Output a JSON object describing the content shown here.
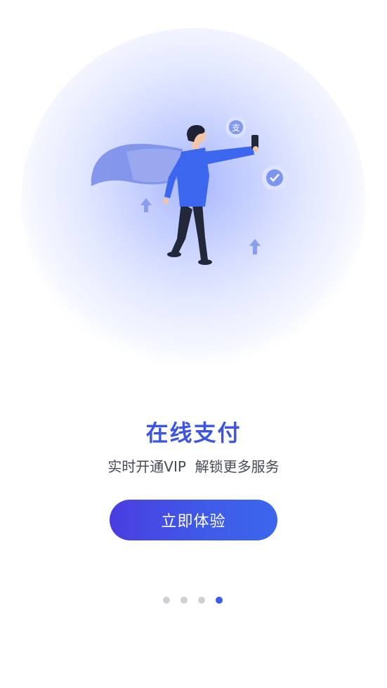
{
  "onboarding": {
    "title": "在线支付",
    "subtitle": "实时开通VIP  解锁更多服务",
    "cta_label": "立即体验",
    "pagination": {
      "total": 4,
      "active_index": 3
    }
  },
  "colors": {
    "accent": "#3d55e0",
    "button_start": "#4a3de0",
    "button_end": "#3b66ec",
    "dot_inactive": "#cfcfd4",
    "dot_active": "#3b5de9"
  },
  "icons": [
    "alipay-icon",
    "wechat-pay-icon",
    "arrow-up-icon"
  ]
}
